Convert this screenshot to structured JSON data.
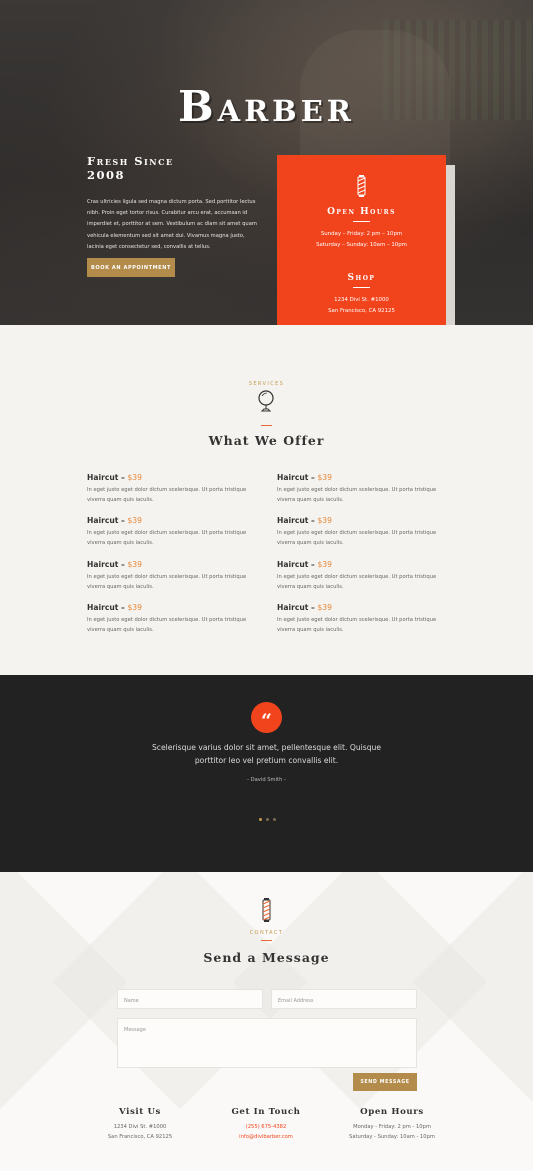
{
  "hero": {
    "title": "Barber",
    "subtitle_line1": "Fresh Since",
    "subtitle_line2": "2008",
    "body": "Cras ultricies ligula sed magna dictum porta. Sed porttitor lectus nibh. Proin eget tortor risus. Curabitur arcu erat, accumsan id imperdiet et, porttitor at sem. Vestibulum ac diam sit amet quam vehicula elementum sed sit amet dui. Vivamus magna justo, lacinia eget consectetur sed, convallis at tellus.",
    "button": "BOOK AN APPOINTMENT",
    "card": {
      "hours_title": "Open Hours",
      "hours_line1": "Sunday – Friday: 2 pm – 10pm",
      "hours_line2": "Saturday – Sunday: 10am – 10pm",
      "shop_title": "Shop",
      "shop_line1": "1234 Divi St. #1000",
      "shop_line2": "San Francisco, CA 92125"
    }
  },
  "services": {
    "eyebrow": "SERVICES",
    "title": "What We Offer",
    "items": [
      {
        "name": "Haircut",
        "price": "$39",
        "desc": "In eget justo eget dolor dictum scelerisque. Ut porta tristique viverra quam quis iaculis."
      },
      {
        "name": "Haircut",
        "price": "$39",
        "desc": "In eget justo eget dolor dictum scelerisque. Ut porta tristique viverra quam quis iaculis."
      },
      {
        "name": "Haircut",
        "price": "$39",
        "desc": "In eget justo eget dolor dictum scelerisque. Ut porta tristique viverra quam quis iaculis."
      },
      {
        "name": "Haircut",
        "price": "$39",
        "desc": "In eget justo eget dolor dictum scelerisque. Ut porta tristique viverra quam quis iaculis."
      },
      {
        "name": "Haircut",
        "price": "$39",
        "desc": "In eget justo eget dolor dictum scelerisque. Ut porta tristique viverra quam quis iaculis."
      },
      {
        "name": "Haircut",
        "price": "$39",
        "desc": "In eget justo eget dolor dictum scelerisque. Ut porta tristique viverra quam quis iaculis."
      },
      {
        "name": "Haircut",
        "price": "$39",
        "desc": "In eget justo eget dolor dictum scelerisque. Ut porta tristique viverra quam quis iaculis."
      },
      {
        "name": "Haircut",
        "price": "$39",
        "desc": "In eget justo eget dolor dictum scelerisque. Ut porta tristique viverra quam quis iaculis."
      }
    ]
  },
  "testimonial": {
    "quote_mark": "“",
    "text": "Scelerisque varius dolor sit amet, pellentesque elit. Quisque porttitor leo vel pretium convallis elit.",
    "author": "- David Smith -"
  },
  "contact": {
    "eyebrow": "CONTACT",
    "title": "Send a Message",
    "name_placeholder": "Name",
    "email_placeholder": "Email Address",
    "message_placeholder": "Message",
    "button": "SEND MESSAGE"
  },
  "footer": {
    "visit_title": "Visit Us",
    "visit_line1": "1234 Divi St. #1000",
    "visit_line2": "San Francisco, CA 92125",
    "touch_title": "Get In Touch",
    "touch_phone": "(255) 675-4382",
    "touch_email": "info@divibarber.com",
    "hours_title": "Open Hours",
    "hours_line1": "Monday - Friday: 2 pm - 10pm",
    "hours_line2": "Saturday - Sunday: 10am - 10pm"
  },
  "colors": {
    "accent_orange": "#f1441d",
    "gold": "#b38b4a",
    "dark": "#222222"
  },
  "icons": [
    "barber-pole-icon",
    "mirror-icon",
    "quote-icon"
  ]
}
